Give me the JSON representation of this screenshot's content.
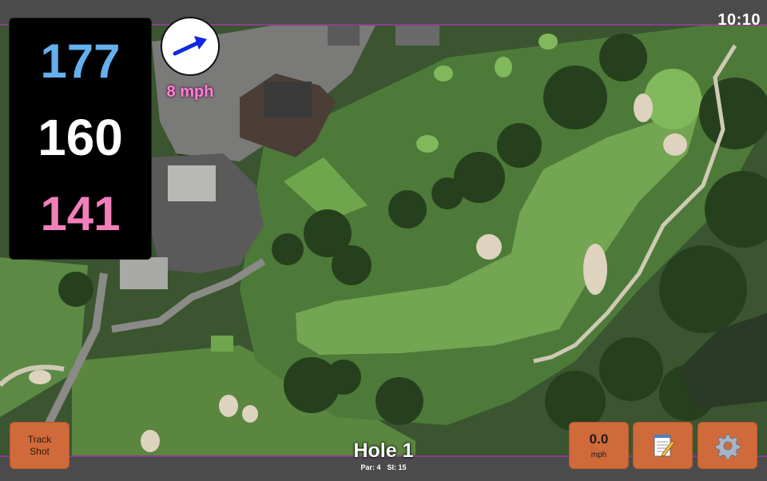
{
  "status": {
    "time": "10:10"
  },
  "distances": {
    "back": "177",
    "middle": "160",
    "front": "141"
  },
  "wind": {
    "speed_label": "8 mph",
    "arrow_color": "#1028e0"
  },
  "controls": {
    "track_shot_line1": "Track",
    "track_shot_line2": "Shot",
    "speed_value": "0.0",
    "speed_unit": "mph",
    "notes_icon": "notepad-icon",
    "settings_icon": "gear-icon"
  },
  "hole": {
    "name": "Hole 1",
    "par": "Par: 4",
    "si": "SI: 15"
  },
  "colors": {
    "accent_border": "#8a3f8a",
    "button": "#d06a3a",
    "back_distance": "#64b0ee",
    "middle_distance": "#ffffff",
    "front_distance": "#f37fba",
    "wind_label": "#f186d0"
  }
}
